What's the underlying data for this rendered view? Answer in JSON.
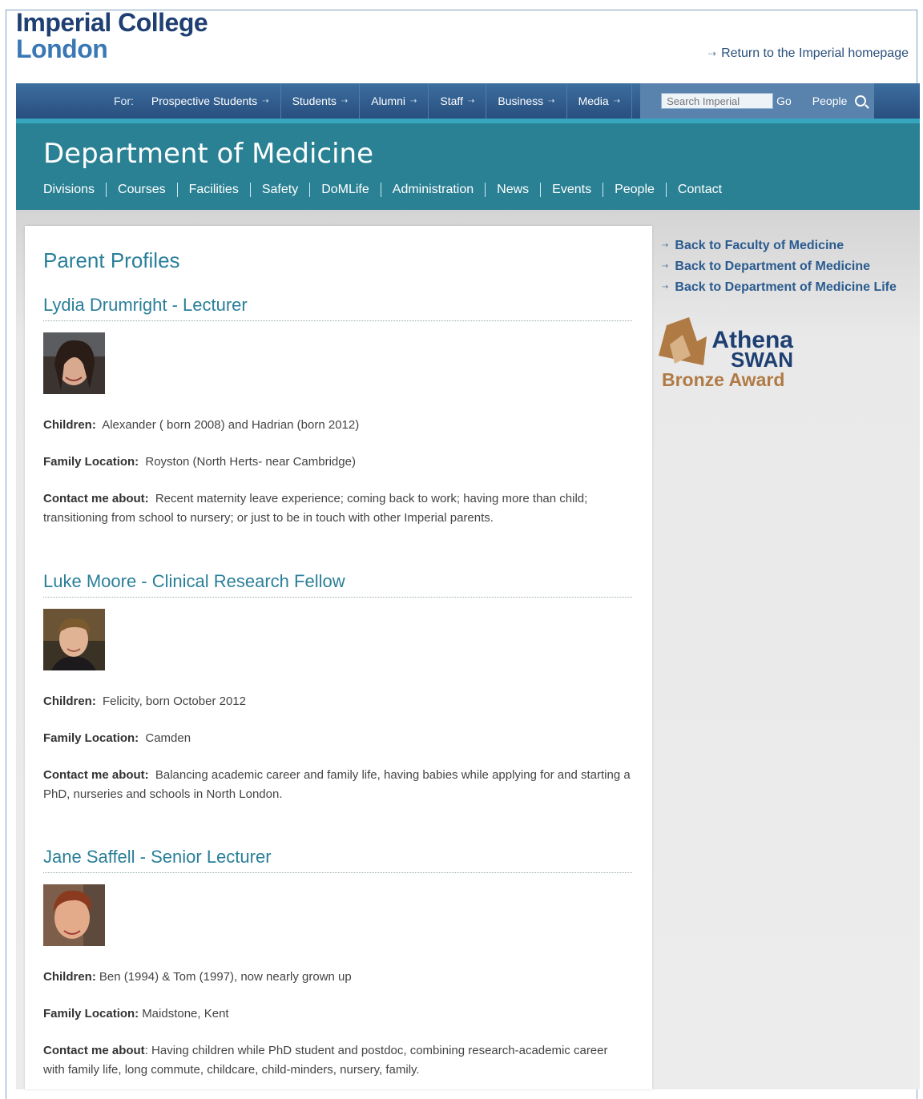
{
  "header": {
    "logo_line1": "Imperial College",
    "logo_line2": "London",
    "return_link": "Return to the Imperial homepage"
  },
  "topnav": {
    "for_label": "For:",
    "items": [
      "Prospective Students",
      "Students",
      "Alumni",
      "Staff",
      "Business",
      "Media"
    ],
    "search_placeholder": "Search Imperial",
    "go_label": "Go",
    "people_label": "People"
  },
  "dept": {
    "title": "Department of Medicine",
    "nav": [
      "Divisions",
      "Courses",
      "Facilities",
      "Safety",
      "DoMLife",
      "Administration",
      "News",
      "Events",
      "People",
      "Contact"
    ]
  },
  "main": {
    "page_title": "Parent Profiles",
    "profiles": [
      {
        "name": "Lydia Drumright - Lecturer",
        "children_label": "Children:",
        "children": "Alexander ( born 2008) and Hadrian (born 2012)",
        "location_label": "Family Location:",
        "location": "Royston (North Herts- near Cambridge)",
        "contact_label": "Contact me about:",
        "contact": "Recent maternity leave experience; coming back to work; having more than child; transitioning from school to nursery; or just to be in touch with other Imperial parents."
      },
      {
        "name": "Luke Moore - Clinical Research Fellow",
        "children_label": "Children:",
        "children": "Felicity, born October 2012",
        "location_label": "Family Location:",
        "location": "Camden",
        "contact_label": "Contact me about:",
        "contact": "Balancing academic career and family life, having babies while applying for and starting a PhD, nurseries and schools in North London."
      },
      {
        "name": "Jane Saffell - Senior Lecturer",
        "children_label": "Children:",
        "children": "Ben (1994) & Tom (1997), now nearly grown up",
        "location_label": "Family Location:",
        "location": "Maidstone, Kent",
        "contact_label": "Contact me about",
        "contact": ": Having children while PhD student and postdoc, combining research-academic career with family life, long commute, childcare, child-minders, nursery, family."
      }
    ]
  },
  "sidebar": {
    "links": [
      "Back to Faculty of Medicine",
      "Back to Department of Medicine",
      "Back to Department of Medicine Life"
    ],
    "award": {
      "line1": "Athena",
      "line2": "SWAN",
      "line3": "Bronze Award",
      "brand_color": "#1e3f72",
      "bronze_color": "#b07a45"
    }
  }
}
